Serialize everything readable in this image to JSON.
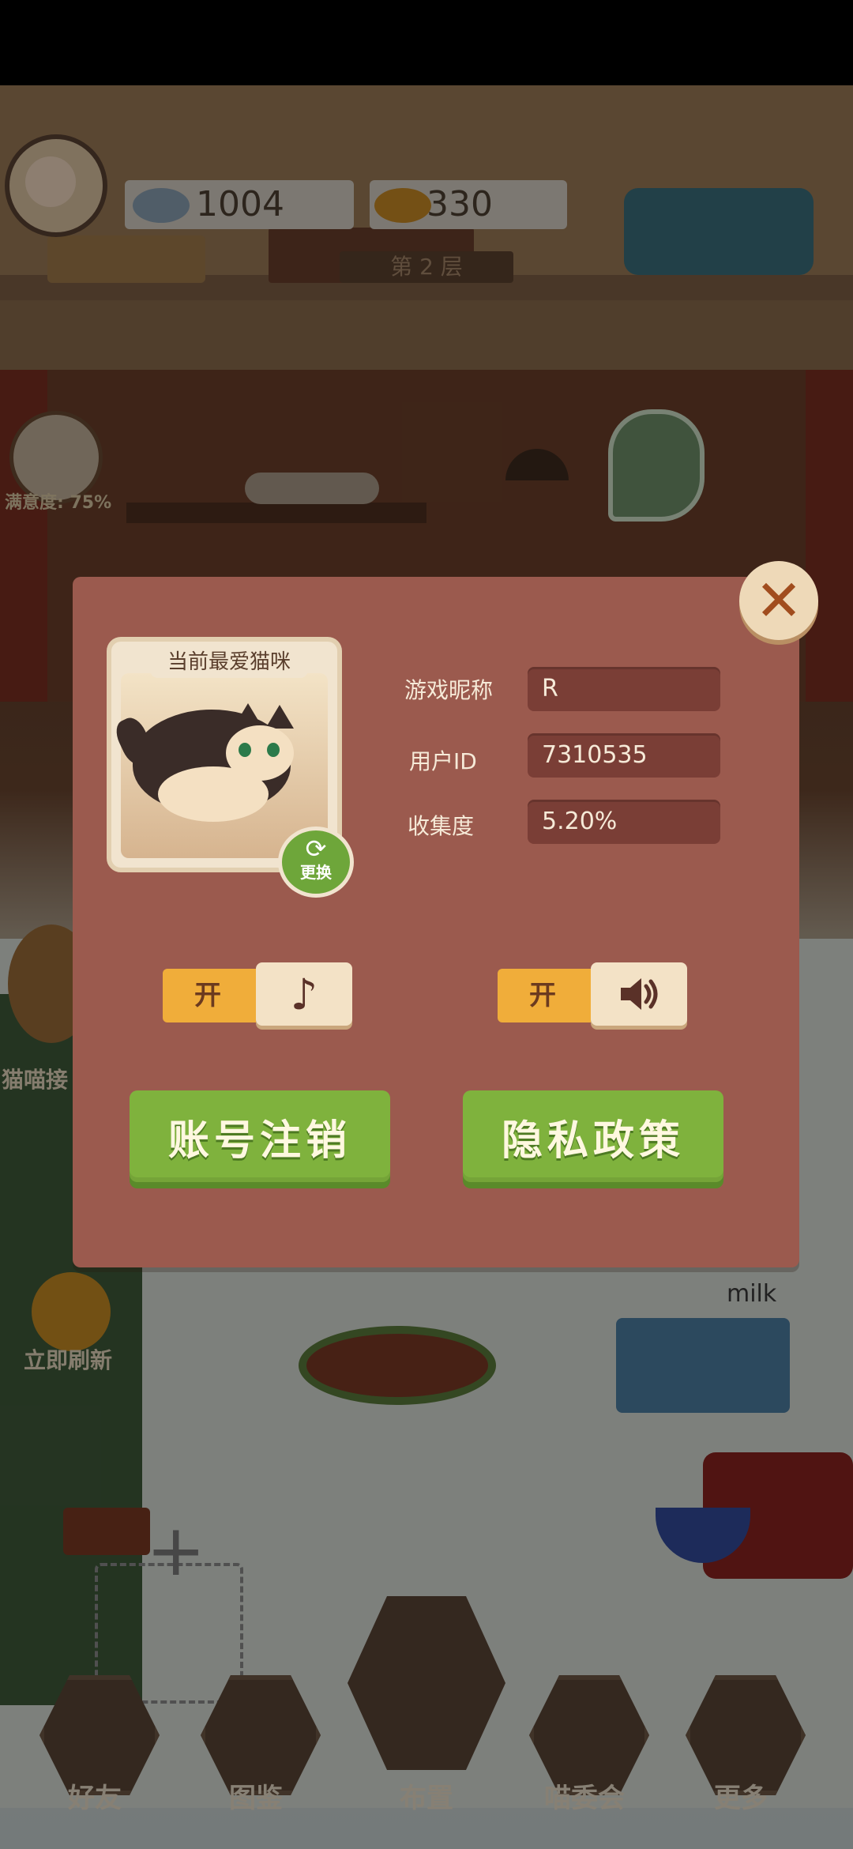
{
  "header": {
    "fish_count": "1004",
    "goldfish_count": "330",
    "floor_label": "第 2 层"
  },
  "side": {
    "fullness_label": "满意度: 75%",
    "cat_event_label": "猫喵接",
    "refresh_label": "立即刷新"
  },
  "scene": {
    "milk_label": "milk"
  },
  "modal": {
    "favorite_cat_title": "当前最爱猫咪",
    "swap_label": "更换",
    "nickname_label": "游戏昵称",
    "nickname_value": "R",
    "user_id_label": "用户ID",
    "user_id_value": "7310535",
    "collection_label": "收集度",
    "collection_value": "5.20%",
    "music_toggle_label": "开",
    "sound_toggle_label": "开",
    "music_icon": "music-note-icon",
    "sound_icon": "speaker-icon",
    "close_icon": "close-icon",
    "account_cancel_button": "账号注销",
    "privacy_policy_button": "隐私政策"
  },
  "bottom_nav": [
    {
      "label": "好友",
      "icon": "friends-icon"
    },
    {
      "label": "图鉴",
      "icon": "catalog-icon"
    },
    {
      "label": "布置",
      "icon": "decorate-icon"
    },
    {
      "label": "喵委会",
      "icon": "cat-committee-icon"
    },
    {
      "label": "更多",
      "icon": "more-icon"
    }
  ],
  "colors": {
    "modal_bg": "#9b5a4e",
    "button_green": "#7fb23d",
    "toggle_orange": "#f0ad3a",
    "field_bg": "#7a3e36"
  }
}
